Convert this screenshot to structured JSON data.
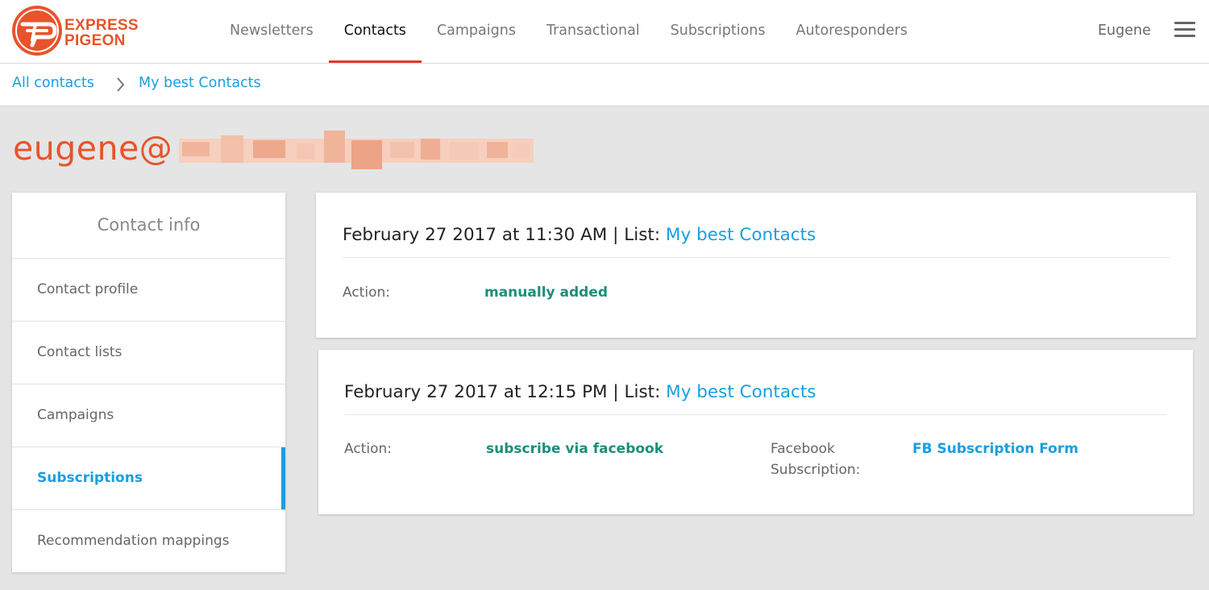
{
  "brand": {
    "logo_line1": "EXPRESS",
    "logo_line2": "PIGEON",
    "color": "#e8532b"
  },
  "nav": {
    "items": [
      {
        "label": "Newsletters",
        "active": false
      },
      {
        "label": "Contacts",
        "active": true
      },
      {
        "label": "Campaigns",
        "active": false
      },
      {
        "label": "Transactional",
        "active": false
      },
      {
        "label": "Subscriptions",
        "active": false
      },
      {
        "label": "Autoresponders",
        "active": false
      }
    ],
    "user": "Eugene",
    "menu_icon": "hamburger-icon"
  },
  "breadcrumb": {
    "root": "All contacts",
    "current": "My best Contacts",
    "separator_icon": "chevron-right-icon"
  },
  "contact": {
    "email_visible": "eugene@",
    "email_domain_redacted": true
  },
  "sidebar": {
    "heading": "Contact info",
    "items": [
      {
        "label": "Contact profile",
        "active": false
      },
      {
        "label": "Contact lists",
        "active": false
      },
      {
        "label": "Campaigns",
        "active": false
      },
      {
        "label": "Subscriptions",
        "active": true
      },
      {
        "label": "Recommendation mappings",
        "active": false
      }
    ]
  },
  "events": [
    {
      "datetime": "February 27 2017 at 11:30 AM | List: ",
      "list_name": "My best Contacts",
      "action_label": "Action:",
      "action_value": "manually added"
    },
    {
      "datetime": "February 27 2017 at 12:15 PM | List: ",
      "list_name": "My best Contacts",
      "action_label": "Action:",
      "action_value": "subscribe via facebook",
      "extra_label_line1": "Facebook",
      "extra_label_line2": "Subscription:",
      "extra_value": "FB Subscription Form"
    }
  ],
  "colors": {
    "accent": "#1a9ee0",
    "brand_orange": "#e8532b",
    "action_green": "#1a8f7a",
    "nav_active_underline": "#e8352b"
  }
}
